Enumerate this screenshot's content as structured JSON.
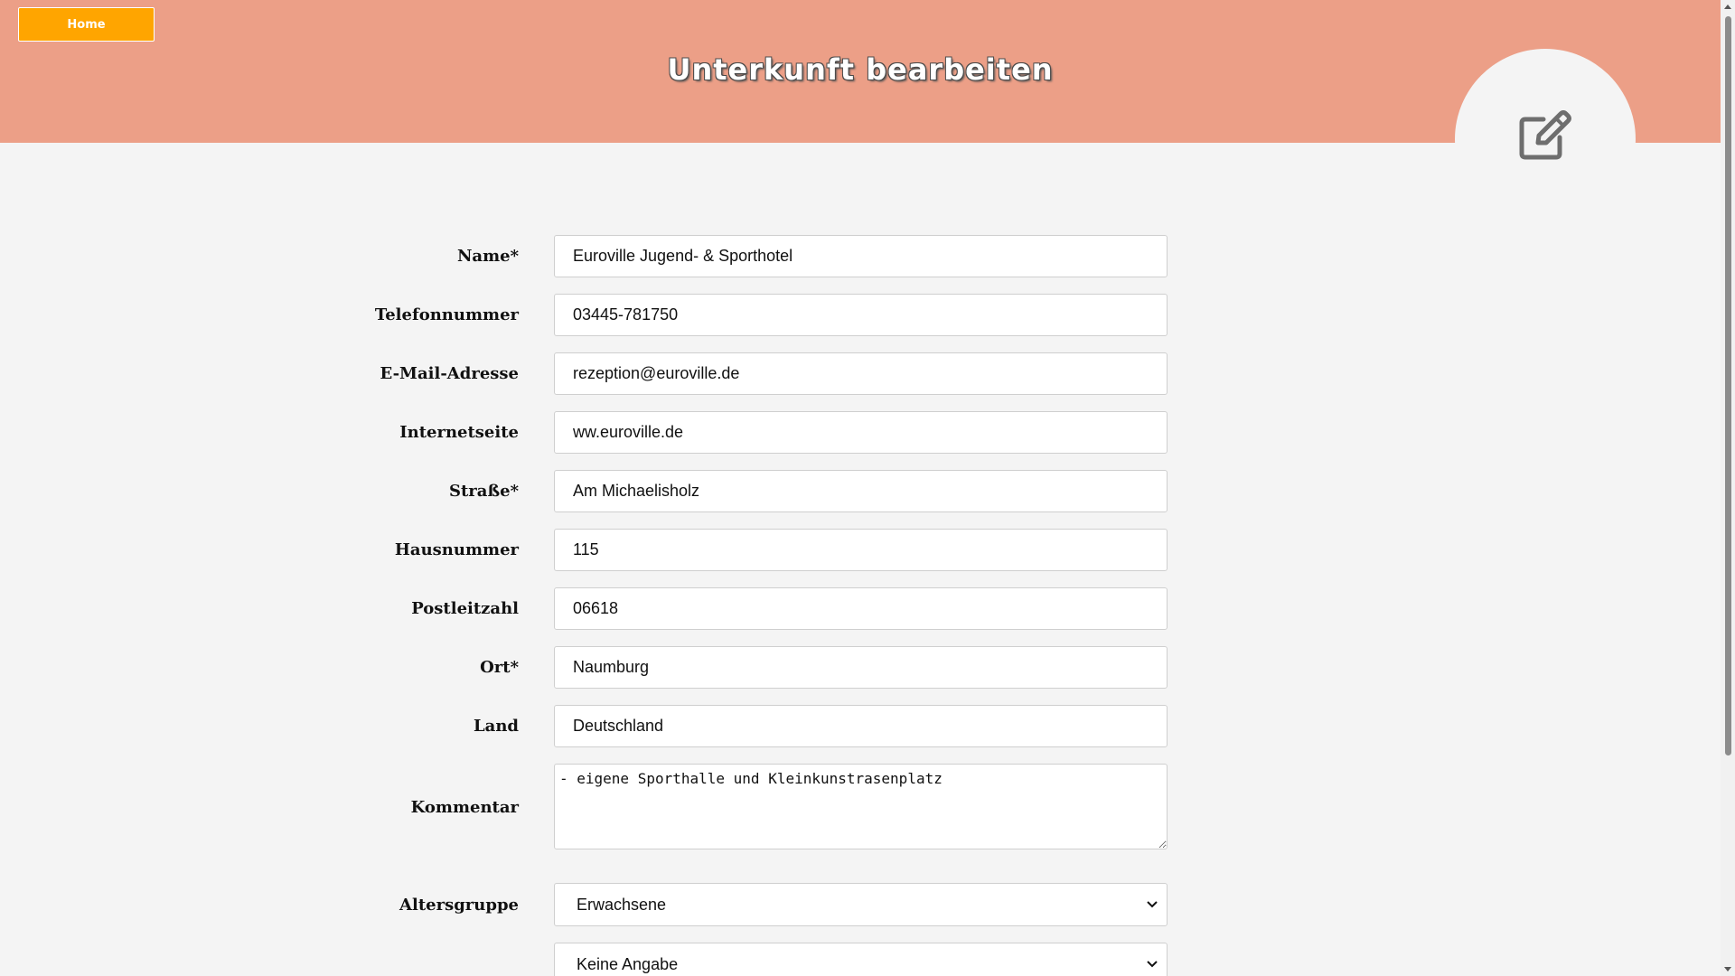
{
  "header": {
    "home_label": "Home",
    "title": "Unterkunft bearbeiten",
    "header_color": "#ec9f87",
    "home_color": "#ffa500",
    "icon": "edit-icon"
  },
  "form": {
    "name": {
      "label": "Name*",
      "value": "Euroville Jugend- & Sporthotel"
    },
    "phone": {
      "label": "Telefonnummer",
      "value": "03445-781750"
    },
    "email": {
      "label": "E-Mail-Adresse",
      "value": "rezeption@euroville.de"
    },
    "website": {
      "label": "Internetseite",
      "value": "ww.euroville.de"
    },
    "street": {
      "label": "Straße*",
      "value": "Am Michaelisholz"
    },
    "house_number": {
      "label": "Hausnummer",
      "value": "115"
    },
    "zip": {
      "label": "Postleitzahl",
      "value": "06618"
    },
    "city": {
      "label": "Ort*",
      "value": "Naumburg"
    },
    "country": {
      "label": "Land",
      "value": "Deutschland"
    },
    "comment": {
      "label": "Kommentar",
      "value": "- eigene Sporthalle und Kleinkunstrasenplatz"
    },
    "age_group": {
      "label": "Altersgruppe",
      "value": "Erwachsene"
    },
    "next_select": {
      "value": "Keine Angabe"
    }
  }
}
